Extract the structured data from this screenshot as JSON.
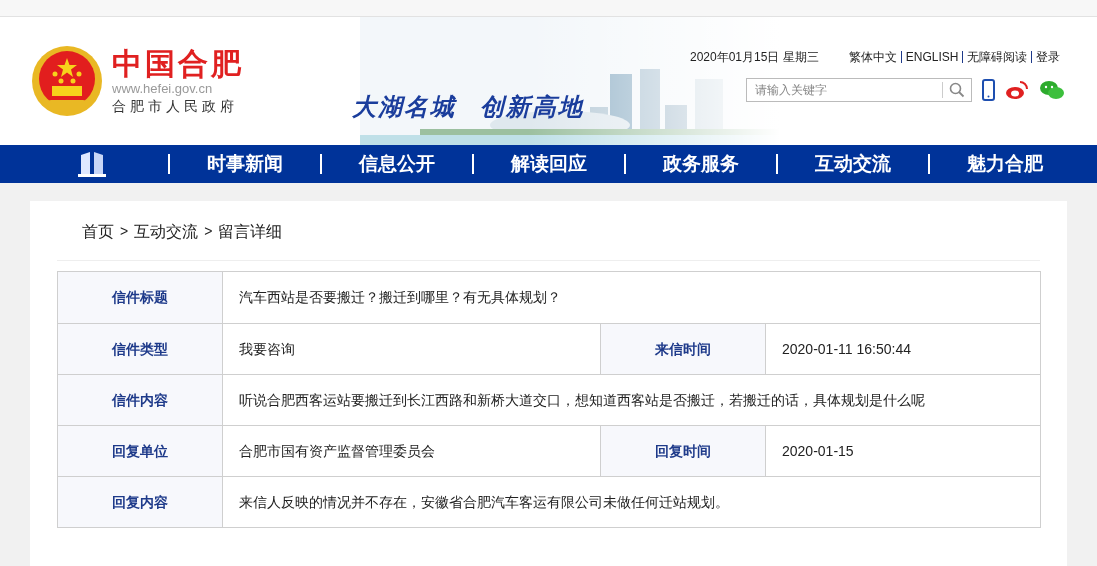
{
  "header": {
    "site_name": "中国合肥",
    "url": "www.hefei.gov.cn",
    "subtitle": "合肥市人民政府",
    "slogan_1": "大湖名城",
    "slogan_2": "创新高地",
    "date": "2020年01月15日 星期三",
    "links": [
      "繁体中文",
      "ENGLISH",
      "无障碍阅读",
      "登录"
    ],
    "search": {
      "placeholder": "请输入关键字"
    }
  },
  "nav": [
    "时事新闻",
    "信息公开",
    "解读回应",
    "政务服务",
    "互动交流",
    "魅力合肥"
  ],
  "breadcrumb": {
    "items": [
      "首页",
      "互动交流",
      "留言详细"
    ],
    "separator": ">"
  },
  "table": [
    {
      "kind": "single",
      "cells": [
        {
          "label": "信件标题",
          "value": "汽车西站是否要搬迁？搬迁到哪里？有无具体规划？"
        }
      ]
    },
    {
      "kind": "double",
      "cells": [
        {
          "label": "信件类型",
          "value": "我要咨询"
        },
        {
          "label": "来信时间",
          "value": "2020-01-11 16:50:44"
        }
      ]
    },
    {
      "kind": "single",
      "cells": [
        {
          "label": "信件内容",
          "value": "听说合肥西客运站要搬迁到长江西路和新桥大道交口，想知道西客站是否搬迁，若搬迁的话，具体规划是什么呢"
        }
      ]
    },
    {
      "kind": "double",
      "cells": [
        {
          "label": "回复单位",
          "value": "合肥市国有资产监督管理委员会"
        },
        {
          "label": "回复时间",
          "value": "2020-01-15"
        }
      ]
    },
    {
      "kind": "single",
      "cells": [
        {
          "label": "回复内容",
          "value": "来信人反映的情况并不存在，安徽省合肥汽车客运有限公司未做任何迁站规划。"
        }
      ]
    }
  ]
}
